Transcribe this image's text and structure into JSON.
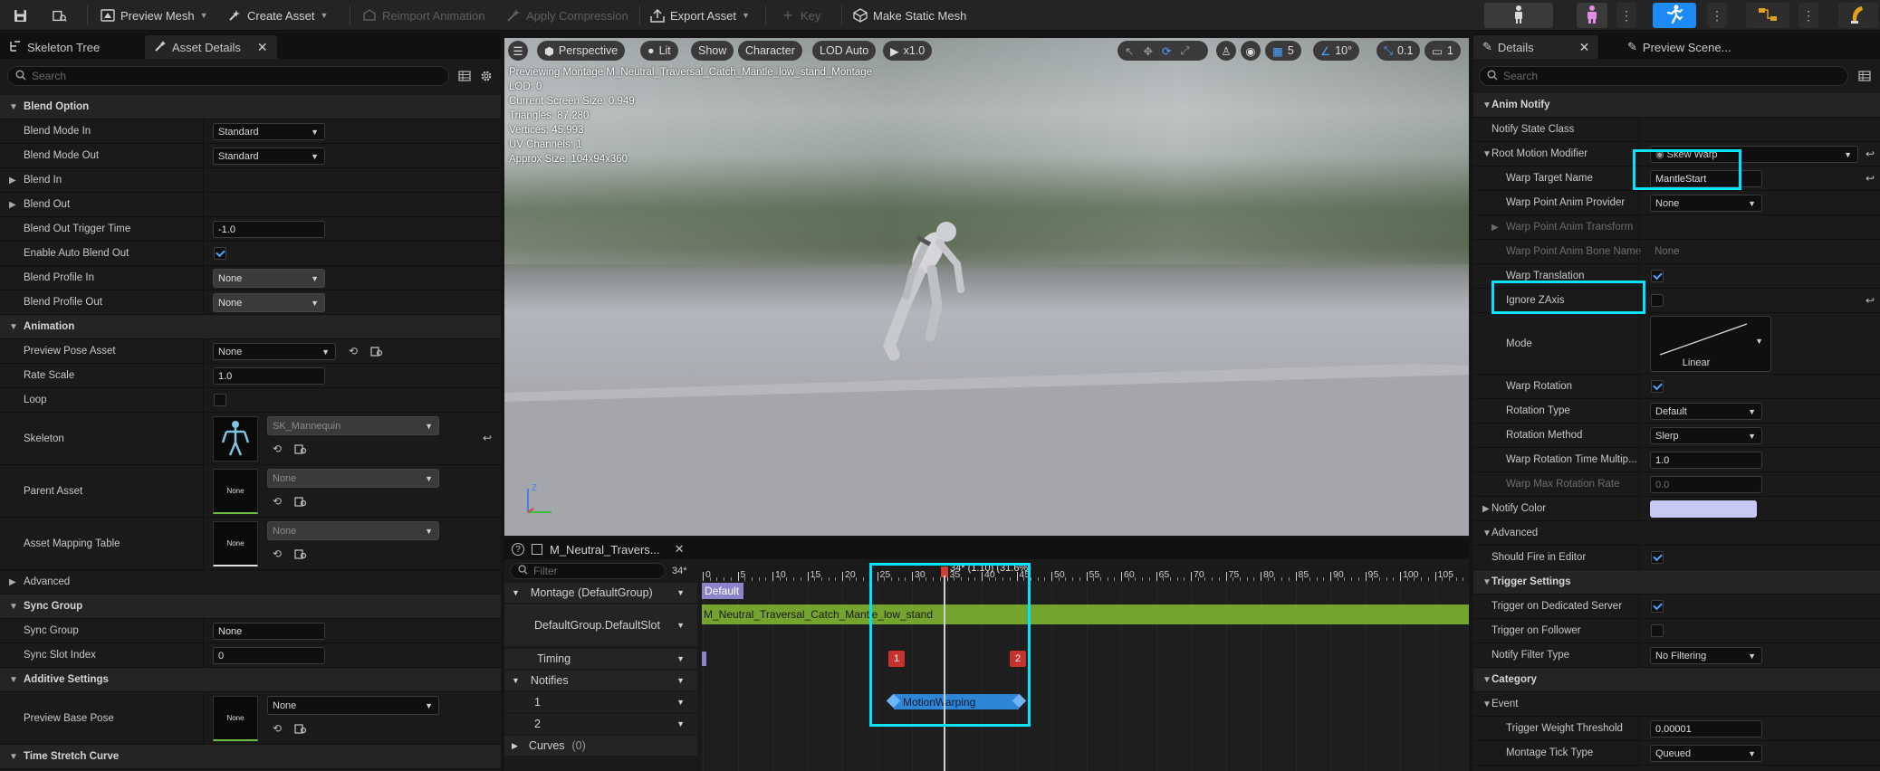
{
  "toolbar": {
    "preview_mesh": "Preview Mesh",
    "create_asset": "Create Asset",
    "reimport": "Reimport Animation",
    "apply_compression": "Apply Compression",
    "export_asset": "Export Asset",
    "key": "Key",
    "make_static_mesh": "Make Static Mesh"
  },
  "left_panel": {
    "tabs": {
      "skeleton_tree": "Skeleton Tree",
      "asset_details": "Asset Details"
    },
    "search_placeholder": "Search",
    "blend_option": {
      "header": "Blend Option",
      "blend_mode_in": {
        "label": "Blend Mode In",
        "value": "Standard"
      },
      "blend_mode_out": {
        "label": "Blend Mode Out",
        "value": "Standard"
      },
      "blend_in": "Blend In",
      "blend_out": "Blend Out",
      "trigger_time": {
        "label": "Blend Out Trigger Time",
        "value": "-1.0"
      },
      "auto_blend_out": "Enable Auto Blend Out",
      "profile_in": {
        "label": "Blend Profile In",
        "value": "None"
      },
      "profile_out": {
        "label": "Blend Profile Out",
        "value": "None"
      }
    },
    "animation": {
      "header": "Animation",
      "preview_pose": {
        "label": "Preview Pose Asset",
        "value": "None"
      },
      "rate_scale": {
        "label": "Rate Scale",
        "value": "1.0"
      },
      "loop": "Loop",
      "skeleton": {
        "label": "Skeleton",
        "value": "SK_Mannequin"
      },
      "parent_asset": {
        "label": "Parent Asset",
        "value": "None",
        "thumb": "None"
      },
      "mapping_table": {
        "label": "Asset Mapping Table",
        "value": "None",
        "thumb": "None"
      }
    },
    "advanced": "Advanced",
    "sync_group": {
      "header": "Sync Group",
      "group": {
        "label": "Sync Group",
        "value": "None"
      },
      "slot_index": {
        "label": "Sync Slot Index",
        "value": "0"
      }
    },
    "additive": {
      "header": "Additive Settings",
      "base_pose": {
        "label": "Preview Base Pose",
        "value": "None",
        "thumb": "None"
      }
    },
    "time_stretch": "Time Stretch Curve"
  },
  "viewport": {
    "perspective": "Perspective",
    "lit": "Lit",
    "show": "Show",
    "character": "Character",
    "lod": "LOD Auto",
    "speed": "x1.0",
    "grid_val": "5",
    "angle_val": "10°",
    "scale_val": "0.1",
    "cam_val": "1",
    "stats": [
      "Previewing Montage M_Neutral_Traversal_Catch_Mantle_low_stand_Montage",
      "LOD: 0",
      "Current Screen Size: 0.949",
      "Triangles: 87,280",
      "Vertices: 45,993",
      "UV Channels: 1",
      "Approx Size: 104x94x360"
    ],
    "axis_z": "Z"
  },
  "sequencer": {
    "tab_title": "M_Neutral_Travers...",
    "filter_placeholder": "Filter",
    "frame": "34*",
    "playhead_label": "34* (1.10) (31.6%)",
    "ticks": [
      "0",
      "5",
      "10",
      "15",
      "20",
      "25",
      "30",
      "35",
      "40",
      "45",
      "50",
      "55",
      "60",
      "65",
      "70",
      "75",
      "80",
      "85",
      "90",
      "95",
      "100",
      "105"
    ],
    "montage_row": "Montage (DefaultGroup)",
    "slot_row": "DefaultGroup.DefaultSlot",
    "section_label": "Default",
    "segment_label": "M_Neutral_Traversal_Catch_Mantle_low_stand",
    "timing": "Timing",
    "timing_markers": [
      "1",
      "2"
    ],
    "notifies": "Notifies",
    "track1": "1",
    "track2": "2",
    "curves": "Curves",
    "curves_count": "(0)",
    "notify_state": "MotionWarping"
  },
  "right_panel": {
    "tabs": {
      "details": "Details",
      "preview_scene": "Preview Scene..."
    },
    "search_placeholder": "Search",
    "anim_notify": "Anim Notify",
    "notify_state_class": "Notify State Class",
    "root_motion_modifier": {
      "label": "Root Motion Modifier",
      "value": "Skew Warp"
    },
    "warp_target_name": {
      "label": "Warp Target Name",
      "value": "MantleStart"
    },
    "warp_point_provider": {
      "label": "Warp Point Anim Provider",
      "value": "None"
    },
    "warp_point_transform": "Warp Point Anim Transform",
    "warp_point_bone": {
      "label": "Warp Point Anim Bone Name",
      "value": "None"
    },
    "warp_translation": "Warp Translation",
    "ignore_zaxis": "Ignore ZAxis",
    "mode": {
      "label": "Mode",
      "value": "Linear"
    },
    "warp_rotation": "Warp Rotation",
    "rotation_type": {
      "label": "Rotation Type",
      "value": "Default"
    },
    "rotation_method": {
      "label": "Rotation Method",
      "value": "Slerp"
    },
    "rotation_time_mult": {
      "label": "Warp Rotation Time Multip...",
      "value": "1.0"
    },
    "max_rotation_rate": {
      "label": "Warp Max Rotation Rate",
      "value": "0.0"
    },
    "notify_color": {
      "label": "Notify Color",
      "value": "#c8c8f4"
    },
    "advanced": "Advanced",
    "should_fire": "Should Fire in Editor",
    "trigger_settings": "Trigger Settings",
    "dedicated_server": "Trigger on Dedicated Server",
    "on_follower": "Trigger on Follower",
    "filter_type": {
      "label": "Notify Filter Type",
      "value": "No Filtering"
    },
    "category": "Category",
    "event": "Event",
    "weight_threshold": {
      "label": "Trigger Weight Threshold",
      "value": "0.00001"
    },
    "tick_type": {
      "label": "Montage Tick Type",
      "value": "Queued"
    }
  },
  "colors": {
    "highlight": "#00e5ff",
    "accent_blue": "#1e8af6",
    "slot_green": "#74a32e",
    "notify_blue": "#2f86d6",
    "marker_red": "#c8322e"
  }
}
